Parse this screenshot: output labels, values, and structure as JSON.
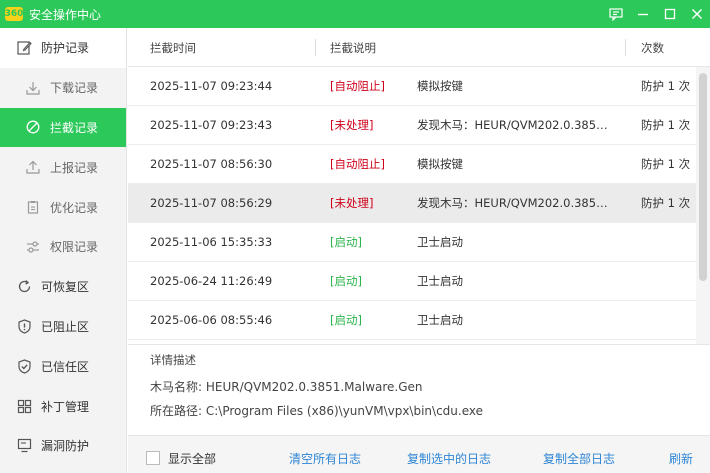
{
  "window": {
    "title": "安全操作中心",
    "logo_text": "360"
  },
  "sidebar": {
    "items": [
      {
        "label": "防护记录",
        "icon": "edit-icon"
      },
      {
        "label": "下载记录",
        "icon": "download-icon"
      },
      {
        "label": "拦截记录",
        "icon": "block-icon"
      },
      {
        "label": "上报记录",
        "icon": "upload-icon"
      },
      {
        "label": "优化记录",
        "icon": "clipboard-icon"
      },
      {
        "label": "权限记录",
        "icon": "sliders-icon"
      },
      {
        "label": "可恢复区",
        "icon": "restore-icon"
      },
      {
        "label": "已阻止区",
        "icon": "shield-alert-icon"
      },
      {
        "label": "已信任区",
        "icon": "shield-check-icon"
      },
      {
        "label": "补丁管理",
        "icon": "grid-icon"
      },
      {
        "label": "漏洞防护",
        "icon": "monitor-icon"
      }
    ]
  },
  "table": {
    "headers": [
      "拦截时间",
      "拦截说明",
      "次数"
    ],
    "rows": [
      {
        "time": "2025-11-07 09:23:44",
        "tag": "[自动阻止]",
        "desc": "模拟按键",
        "count": "防护 1 次"
      },
      {
        "time": "2025-11-07 09:23:43",
        "tag": "[未处理]",
        "desc": "发现木马：HEUR/QVM202.0.3851...",
        "count": "防护 1 次"
      },
      {
        "time": "2025-11-07 08:56:30",
        "tag": "[自动阻止]",
        "desc": "模拟按键",
        "count": "防护 1 次"
      },
      {
        "time": "2025-11-07 08:56:29",
        "tag": "[未处理]",
        "desc": "发现木马：HEUR/QVM202.0.3851...",
        "count": "防护 1 次"
      },
      {
        "time": "2025-11-06 15:35:33",
        "tag": "[启动]",
        "desc": "卫士启动",
        "count": ""
      },
      {
        "time": "2025-06-24 11:26:49",
        "tag": "[启动]",
        "desc": "卫士启动",
        "count": ""
      },
      {
        "time": "2025-06-06 08:55:46",
        "tag": "[启动]",
        "desc": "卫士启动",
        "count": ""
      }
    ]
  },
  "details": {
    "title": "详情描述",
    "name_line": "木马名称:  HEUR/QVM202.0.3851.Malware.Gen",
    "path_line": "所在路径:  C:\\Program Files (x86)\\yunVM\\vpx\\bin\\cdu.exe"
  },
  "footer": {
    "show_all": "显示全部",
    "clear_all": "清空所有日志",
    "copy_selected": "复制选中的日志",
    "copy_all": "复制全部日志",
    "refresh": "刷新"
  },
  "colors": {
    "accent": "#2cc85a",
    "tag_red": "#d0021b",
    "tag_green": "#2cb54c",
    "link": "#2e86d6"
  }
}
